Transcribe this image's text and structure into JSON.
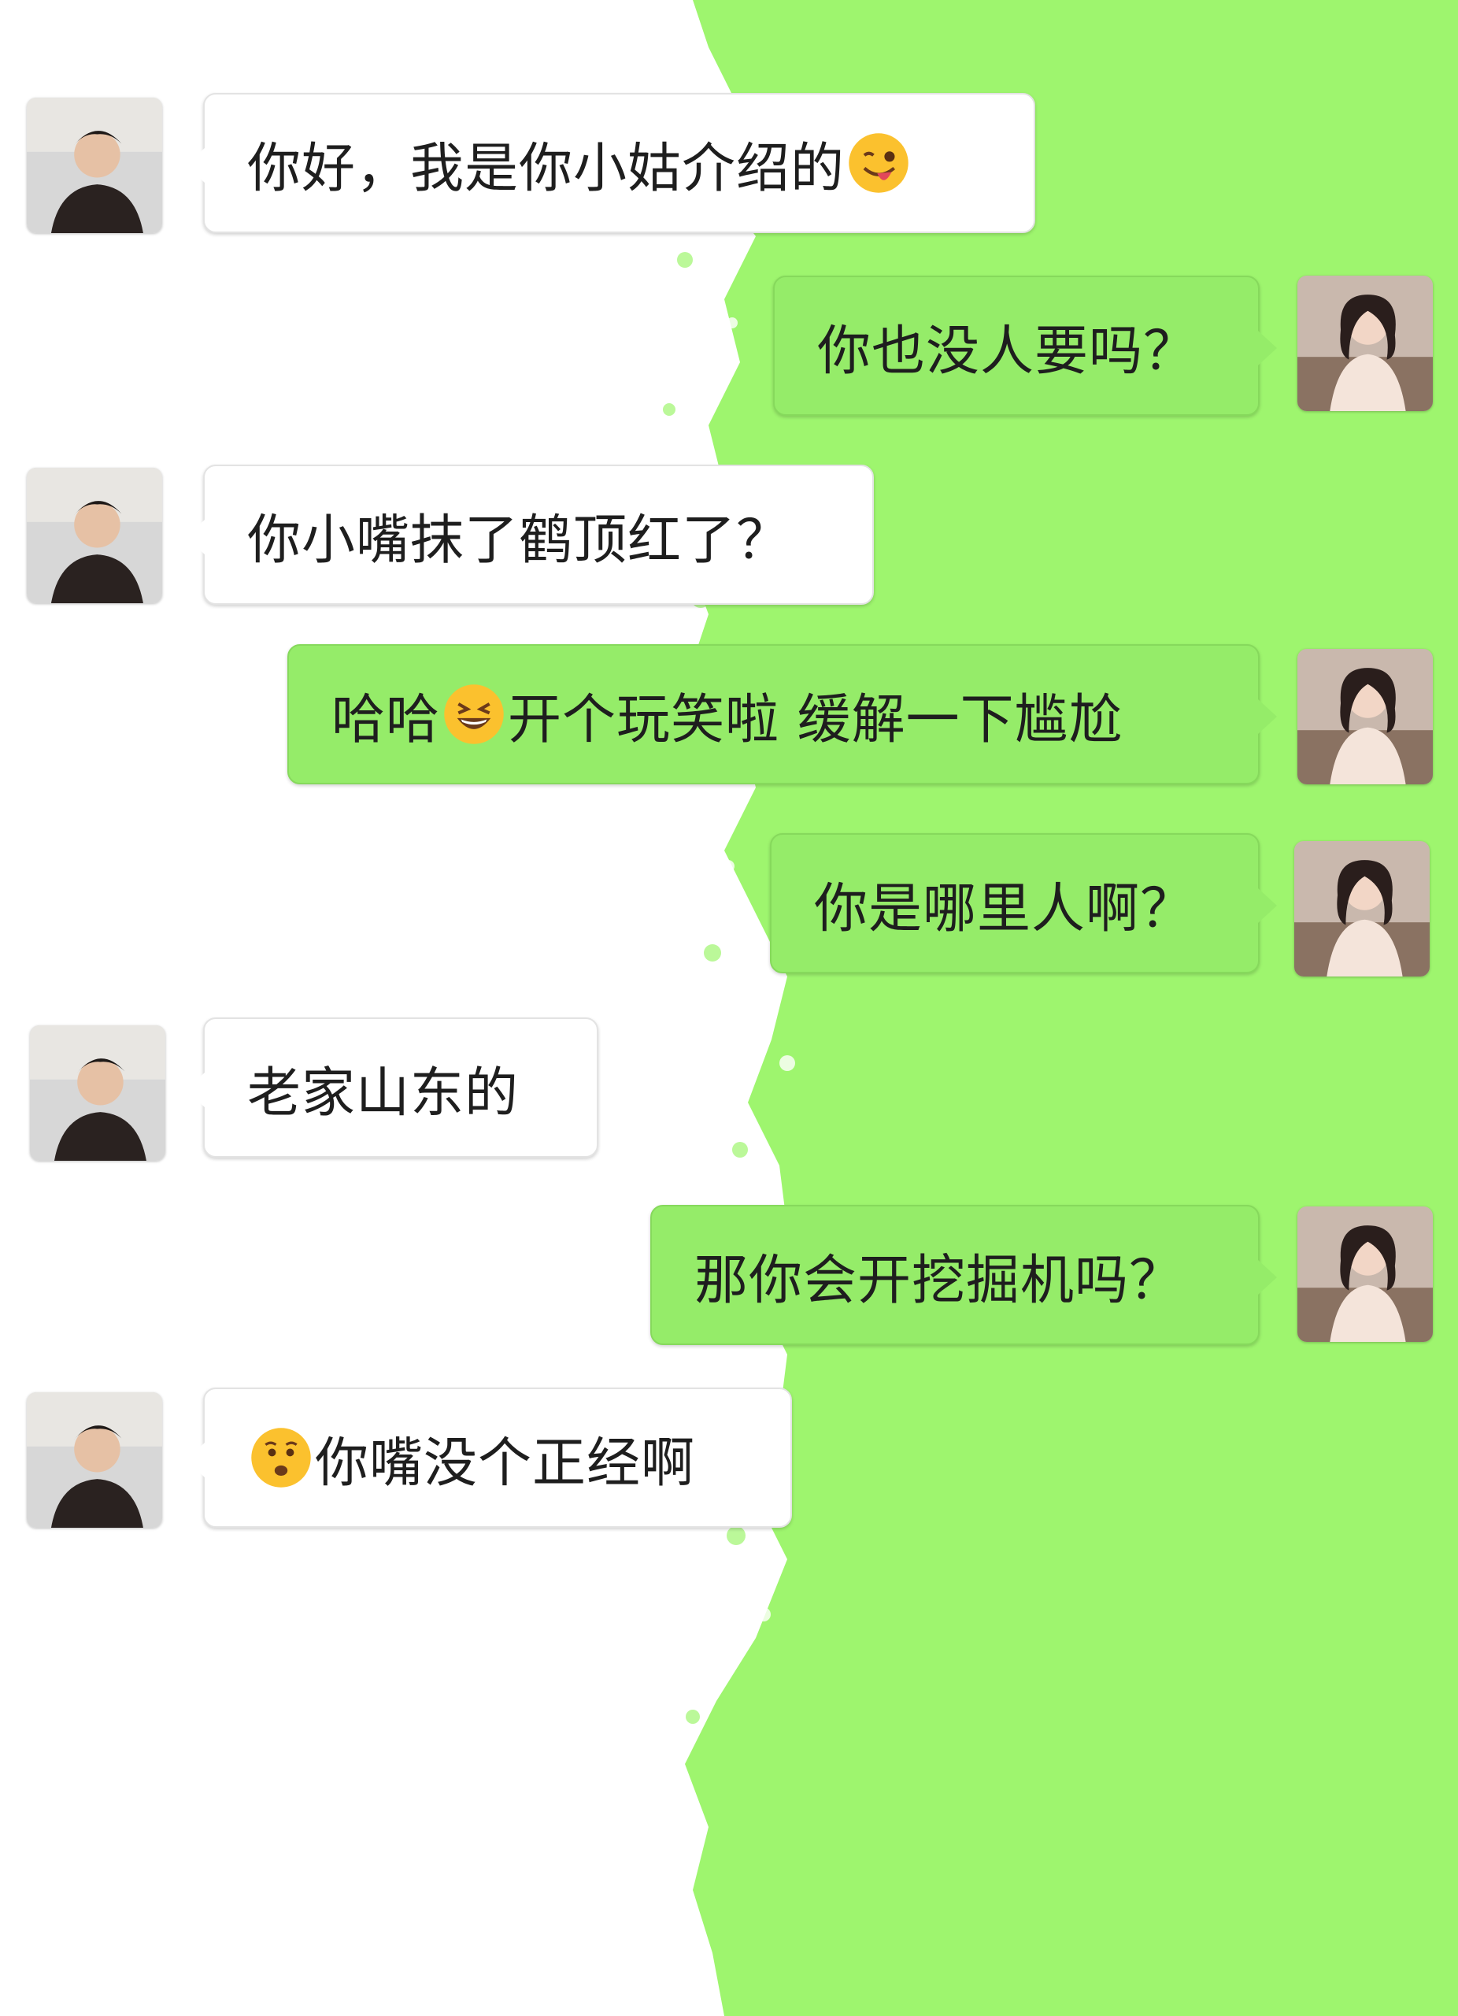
{
  "colors": {
    "incoming_bubble": "#ffffff",
    "outgoing_bubble": "#95ec69",
    "background_left": "#ffffff",
    "background_right": "#9ef56e"
  },
  "messages": [
    {
      "sender": "him",
      "text_before": "",
      "emoji": "winking-tongue",
      "text": "你好，我是你小姑介绍的",
      "emoji_position": "end"
    },
    {
      "sender": "her",
      "text": "你也没人要吗？"
    },
    {
      "sender": "him",
      "text": "你小嘴抹了鹤顶红了？"
    },
    {
      "sender": "her",
      "text_before": "哈哈",
      "emoji": "grinning-squinting",
      "text": "开个玩笑啦 缓解一下尴尬",
      "emoji_position": "middle"
    },
    {
      "sender": "her",
      "text": "你是哪里人啊？"
    },
    {
      "sender": "him",
      "text": "老家山东的"
    },
    {
      "sender": "her",
      "text": "那你会开挖掘机吗？"
    },
    {
      "sender": "him",
      "emoji": "worried",
      "text": "你嘴没个正经啊",
      "emoji_position": "start"
    }
  ]
}
